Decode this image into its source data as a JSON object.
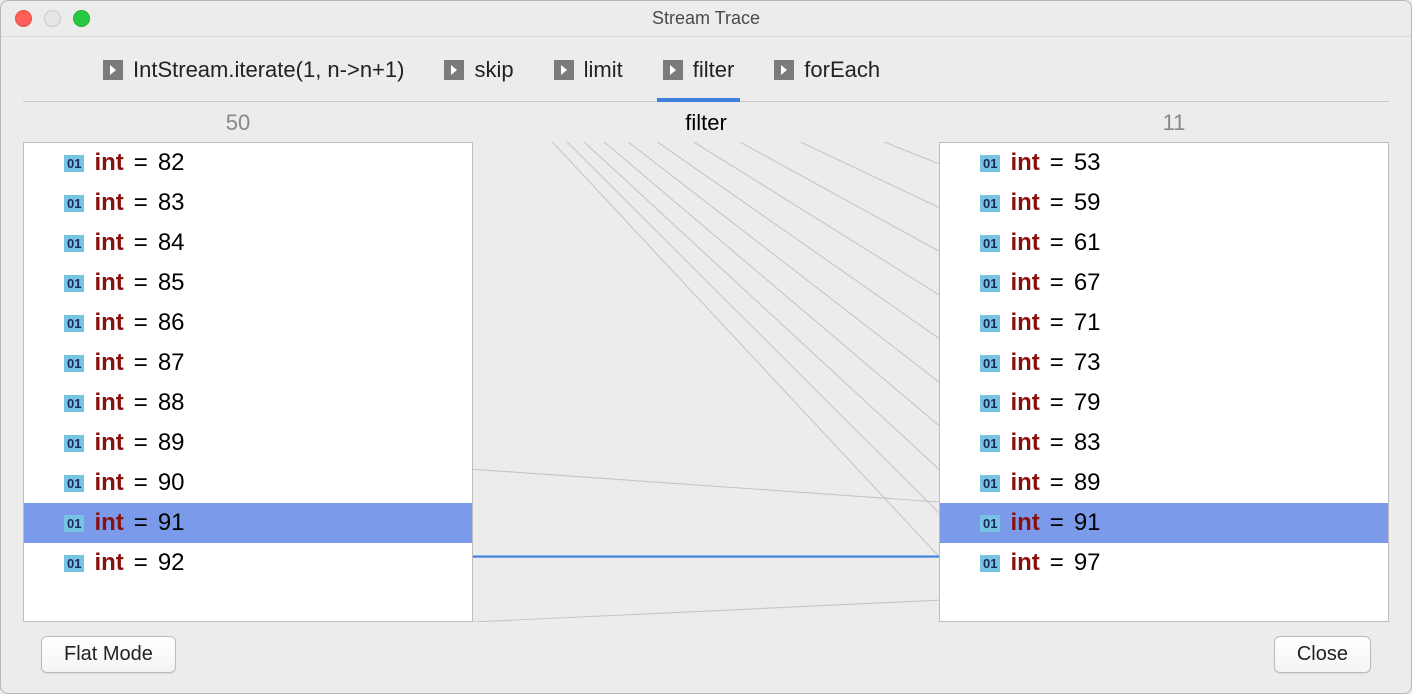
{
  "window": {
    "title": "Stream Trace"
  },
  "tabs": [
    {
      "label": "IntStream.iterate(1, n->n+1)",
      "active": false
    },
    {
      "label": "skip",
      "active": false
    },
    {
      "label": "limit",
      "active": false
    },
    {
      "label": "filter",
      "active": true
    },
    {
      "label": "forEach",
      "active": false
    }
  ],
  "header": {
    "left_count": "50",
    "stage_name": "filter",
    "right_count": "11"
  },
  "left_list": [
    {
      "type": "int",
      "value": "82",
      "selected": false
    },
    {
      "type": "int",
      "value": "83",
      "selected": false
    },
    {
      "type": "int",
      "value": "84",
      "selected": false
    },
    {
      "type": "int",
      "value": "85",
      "selected": false
    },
    {
      "type": "int",
      "value": "86",
      "selected": false
    },
    {
      "type": "int",
      "value": "87",
      "selected": false
    },
    {
      "type": "int",
      "value": "88",
      "selected": false
    },
    {
      "type": "int",
      "value": "89",
      "selected": false
    },
    {
      "type": "int",
      "value": "90",
      "selected": false
    },
    {
      "type": "int",
      "value": "91",
      "selected": true
    },
    {
      "type": "int",
      "value": "92",
      "selected": false
    }
  ],
  "right_list": [
    {
      "type": "int",
      "value": "53",
      "selected": false
    },
    {
      "type": "int",
      "value": "59",
      "selected": false
    },
    {
      "type": "int",
      "value": "61",
      "selected": false
    },
    {
      "type": "int",
      "value": "67",
      "selected": false
    },
    {
      "type": "int",
      "value": "71",
      "selected": false
    },
    {
      "type": "int",
      "value": "73",
      "selected": false
    },
    {
      "type": "int",
      "value": "79",
      "selected": false
    },
    {
      "type": "int",
      "value": "83",
      "selected": false
    },
    {
      "type": "int",
      "value": "89",
      "selected": false
    },
    {
      "type": "int",
      "value": "91",
      "selected": true
    },
    {
      "type": "int",
      "value": "97",
      "selected": false
    }
  ],
  "badge_text": "01",
  "buttons": {
    "flat_mode": "Flat Mode",
    "close": "Close"
  },
  "colors": {
    "selection": "#7c9aea",
    "accent": "#3e7fe0",
    "keyword": "#8a0f0f",
    "badge_bg": "#77c3e4"
  }
}
